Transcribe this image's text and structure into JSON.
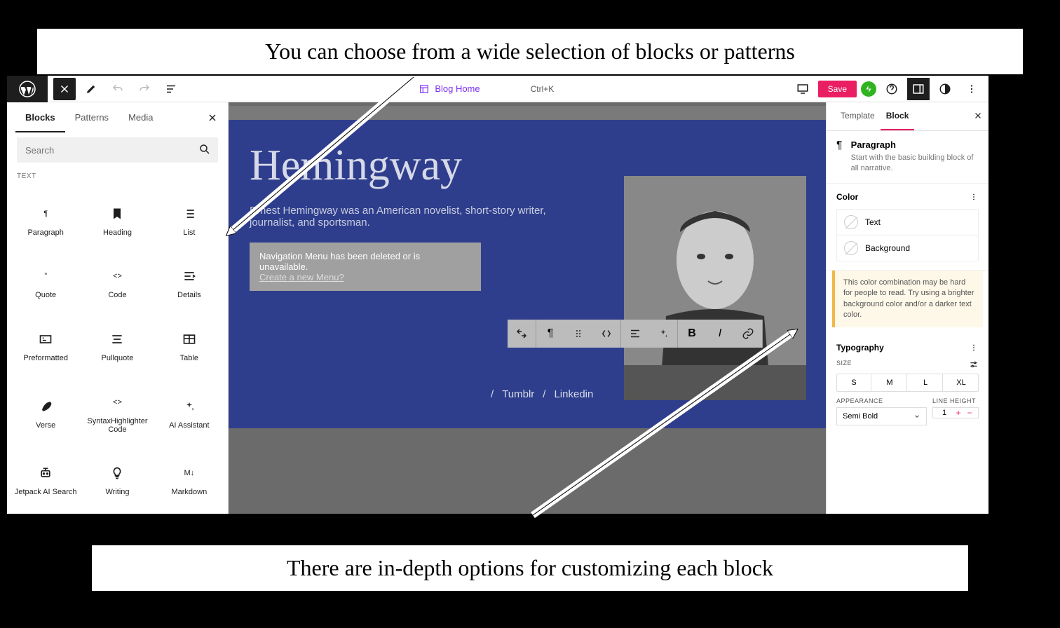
{
  "callouts": {
    "top": "You can choose from a wide selection of blocks or patterns",
    "bottom": "There are in-depth options for customizing each block"
  },
  "breadcrumb": {
    "label": "Blog Home",
    "shortcut": "Ctrl+K"
  },
  "save_label": "Save",
  "left": {
    "tabs": {
      "blocks": "Blocks",
      "patterns": "Patterns",
      "media": "Media"
    },
    "search_placeholder": "Search",
    "section": "TEXT",
    "blocks": [
      {
        "name": "Paragraph",
        "icon": "¶"
      },
      {
        "name": "Heading",
        "icon": "bookmark"
      },
      {
        "name": "List",
        "icon": "list"
      },
      {
        "name": "Quote",
        "icon": "”"
      },
      {
        "name": "Code",
        "icon": "<>"
      },
      {
        "name": "Details",
        "icon": "details"
      },
      {
        "name": "Preformatted",
        "icon": "preformatted"
      },
      {
        "name": "Pullquote",
        "icon": "pullquote"
      },
      {
        "name": "Table",
        "icon": "table"
      },
      {
        "name": "Verse",
        "icon": "feather"
      },
      {
        "name": "SyntaxHighlighter Code",
        "icon": "<>"
      },
      {
        "name": "AI Assistant",
        "icon": "sparkle"
      },
      {
        "name": "Jetpack AI Search",
        "icon": "robot"
      },
      {
        "name": "Writing",
        "icon": "bulb"
      },
      {
        "name": "Markdown",
        "icon": "M↓"
      }
    ]
  },
  "canvas": {
    "title": "Hemingway",
    "desc": "Ernest Hemingway was an American novelist, short-story writer, journalist, and sportsman.",
    "nav_warn": "Navigation Menu has been deleted or is unavailable.",
    "nav_link": "Create a new Menu?",
    "social": [
      "Tumblr",
      "Linkedin"
    ]
  },
  "right": {
    "tabs": {
      "template": "Template",
      "block": "Block"
    },
    "block_name": "Paragraph",
    "block_desc": "Start with the basic building block of all narrative.",
    "color": {
      "label": "Color",
      "text": "Text",
      "background": "Background",
      "warn": "This color combination may be hard for people to read. Try using a brighter background color and/or a darker text color."
    },
    "typography": {
      "label": "Typography",
      "size_label": "SIZE",
      "sizes": [
        "S",
        "M",
        "L",
        "XL"
      ],
      "appearance_label": "APPEARANCE",
      "appearance_value": "Semi Bold",
      "line_height_label": "LINE HEIGHT",
      "line_height_value": "1"
    }
  }
}
